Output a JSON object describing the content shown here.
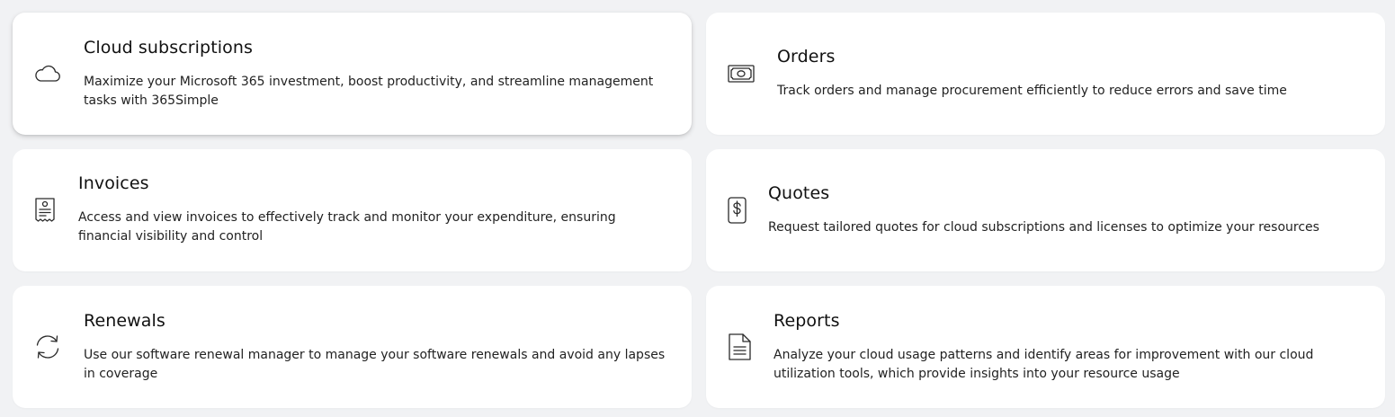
{
  "cards": [
    {
      "title": "Cloud subscriptions",
      "description": "Maximize your Microsoft 365 investment, boost productivity, and streamline management tasks with 365Simple",
      "icon": "cloud-icon"
    },
    {
      "title": "Orders",
      "description": "Track orders and manage procurement efficiently to reduce errors and save time",
      "icon": "banknote-icon"
    },
    {
      "title": "Invoices",
      "description": "Access and view invoices to effectively track and monitor your expenditure, ensuring financial visibility and control",
      "icon": "receipt-icon"
    },
    {
      "title": "Quotes",
      "description": "Request tailored quotes for cloud subscriptions and licenses to optimize your resources",
      "icon": "dollar-document-icon"
    },
    {
      "title": "Renewals",
      "description": "Use our software renewal manager to manage your software renewals and avoid any lapses in coverage",
      "icon": "refresh-icon"
    },
    {
      "title": "Reports",
      "description": "Analyze your cloud usage patterns and identify areas for improvement with our cloud utilization tools, which provide insights into your resource usage",
      "icon": "document-icon"
    }
  ],
  "colors": {
    "background": "#f1f2f4",
    "card": "#ffffff",
    "text": "#1a1a1a"
  }
}
